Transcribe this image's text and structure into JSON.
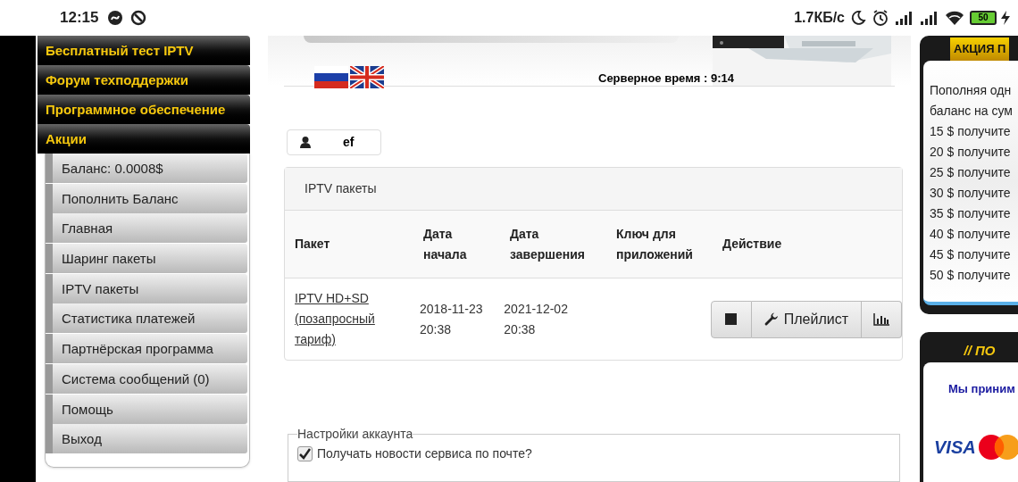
{
  "status_bar": {
    "time": "12:15",
    "net_speed": "1.7КБ/с",
    "battery": "50"
  },
  "sidebar": {
    "top_items": [
      {
        "label": "Бесплатный тест IPTV"
      },
      {
        "label": "Форум техподдержки"
      },
      {
        "label": "Программное обеспечение"
      },
      {
        "label": "Акции"
      }
    ],
    "items": [
      {
        "label": "Баланс: 0.0008$"
      },
      {
        "label": "Пополнить Баланс"
      },
      {
        "label": "Главная"
      },
      {
        "label": "Шаринг пакеты"
      },
      {
        "label": "IPTV пакеты"
      },
      {
        "label": "Статистика платежей"
      },
      {
        "label": "Партнёрская программа"
      },
      {
        "label": "Система сообщений (0)"
      },
      {
        "label": "Помощь"
      },
      {
        "label": "Выход"
      }
    ]
  },
  "header": {
    "server_time": "Серверное время : 9:14"
  },
  "user": {
    "name": "ef"
  },
  "packages": {
    "title": "IPTV пакеты",
    "columns": [
      "Пакет",
      "Дата начала",
      "Дата завершения",
      "Ключ для приложений",
      "Действие"
    ],
    "rows": [
      {
        "package": "IPTV HD+SD (позапросный тариф)",
        "start": "2018-11-23 20:38",
        "end": "2021-12-02 20:38",
        "playlist_button": "Плейлист"
      }
    ]
  },
  "settings": {
    "legend": "Настройки аккаунта",
    "options": [
      {
        "label": "Получать новости сервиса по почте?",
        "checked": true
      }
    ]
  },
  "promo": {
    "title": "АКЦИЯ П",
    "lines": [
      "Пополняя одн",
      "баланс на сум",
      "15 $ получите",
      "20 $ получите",
      "25 $ получите",
      "30 $ получите",
      "35 $ получите",
      "40 $ получите",
      "45 $ получите",
      "50 $ получите"
    ]
  },
  "payments": {
    "title": "// ПО",
    "text": "Мы приним",
    "visa": "VISA"
  }
}
